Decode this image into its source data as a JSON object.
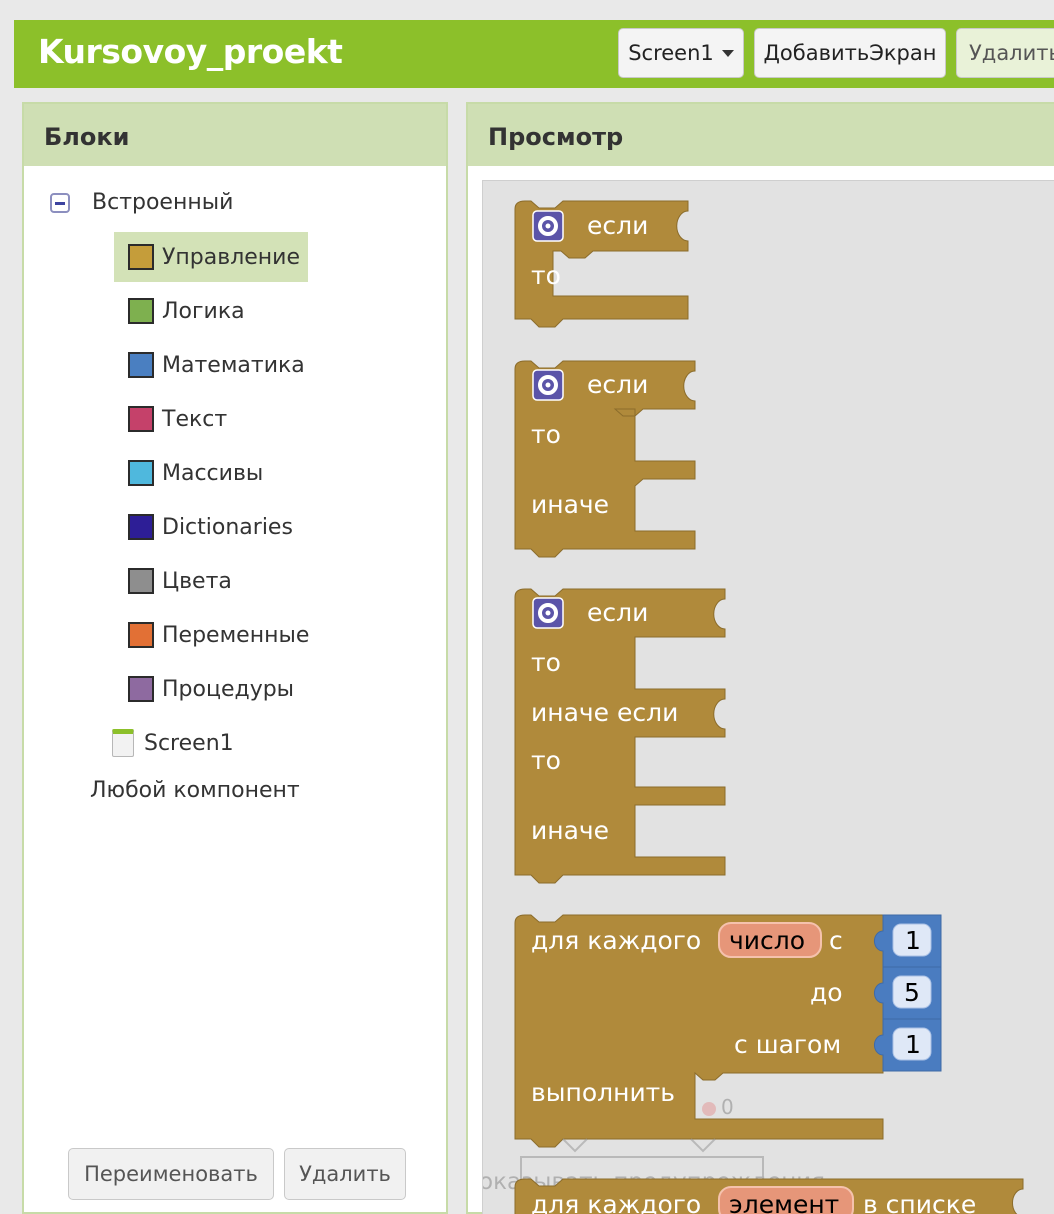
{
  "header": {
    "app_title": "Kursovoy_proekt",
    "screen_select": "Screen1",
    "add_screen_label": "ДобавитьЭкран",
    "remove_screen_label": "Удалить"
  },
  "blocks_panel": {
    "title": "Блоки",
    "builtin_label": "Встроенный",
    "categories": [
      {
        "label": "Управление",
        "color": "#c59d3a"
      },
      {
        "label": "Логика",
        "color": "#7eb04f"
      },
      {
        "label": "Математика",
        "color": "#4a7fc1"
      },
      {
        "label": "Текст",
        "color": "#c5416a"
      },
      {
        "label": "Массивы",
        "color": "#4fb8dd"
      },
      {
        "label": "Dictionaries",
        "color": "#2d1e96"
      },
      {
        "label": "Цвета",
        "color": "#8e8e8e"
      },
      {
        "label": "Переменные",
        "color": "#e27035"
      },
      {
        "label": "Процедуры",
        "color": "#8e6aa0"
      }
    ],
    "screen_label": "Screen1",
    "any_component_label": "Любой компонент",
    "rename_label": "Переименовать",
    "delete_label": "Удалить"
  },
  "viewer": {
    "title": "Просмотр",
    "block_color": "#b08a3b",
    "if_label": "если",
    "then_label": "то",
    "else_label": "иначе",
    "else_if_label": "иначе если",
    "for_each_label": "для каждого",
    "number_var": "число",
    "from_label": "с",
    "to_label": "до",
    "step_label": "с шагом",
    "do_label": "выполнить",
    "from_value": "1",
    "to_value": "5",
    "step_value": "1",
    "warning_count": "0",
    "warnings_text": "оказывать предупреждения",
    "item_var": "элемент",
    "in_list_label": "в списке"
  }
}
